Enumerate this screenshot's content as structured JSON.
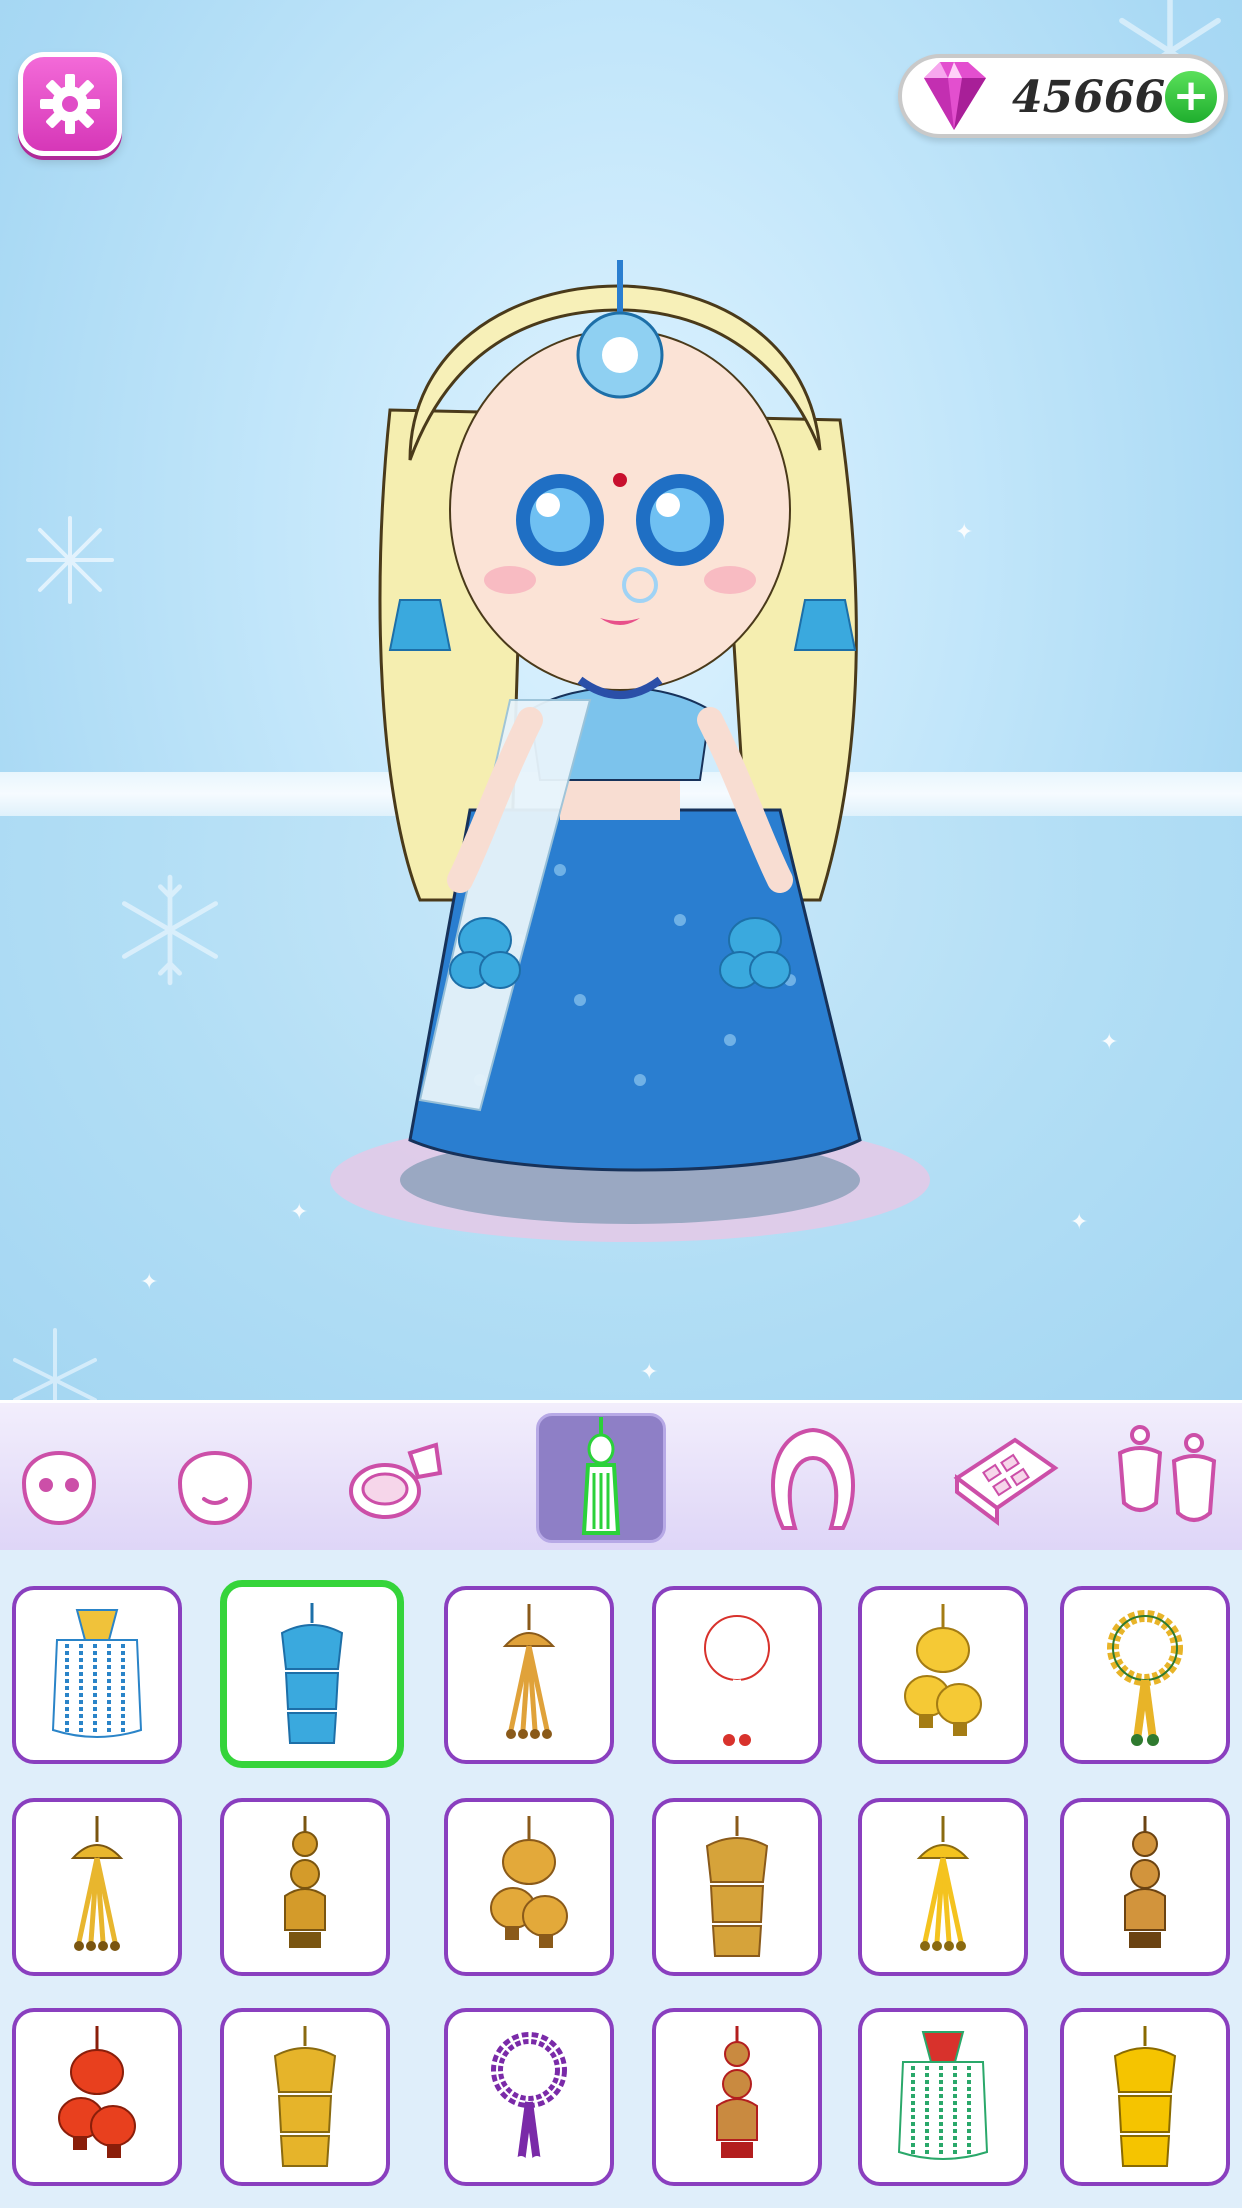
{
  "hud": {
    "gem_count": "45666",
    "settings_icon": "gear-icon",
    "gem_icon": "diamond-gem-icon",
    "add_icon": "plus-icon",
    "add_label": "+"
  },
  "colors": {
    "settings_bg": "#e04cc7",
    "selected_tile_border": "#35d43a",
    "tile_border": "#8a3fbf",
    "active_category_bg": "#8e7fc6"
  },
  "categories": [
    {
      "name": "face-base",
      "icon": "face-base-icon"
    },
    {
      "name": "face-shape",
      "icon": "smiling-face-icon"
    },
    {
      "name": "makeup",
      "icon": "makeup-compact-brush-icon"
    },
    {
      "name": "latkan-tassel",
      "icon": "tassel-icon",
      "active": true
    },
    {
      "name": "hair",
      "icon": "hair-icon"
    },
    {
      "name": "eyeshadow-palette",
      "icon": "eyeshadow-palette-icon"
    },
    {
      "name": "earrings",
      "icon": "earrings-icon"
    }
  ],
  "items": [
    {
      "icon": "beaded-tassel-icon",
      "colors": [
        "#f0c23a",
        "#2a84c8"
      ]
    },
    {
      "icon": "blue-bell-tassel-icon",
      "colors": [
        "#3aa9de",
        "#1d6fa8"
      ],
      "selected": true
    },
    {
      "icon": "gold-bell-tassel-icon",
      "colors": [
        "#e0a23a",
        "#8a5a1a"
      ]
    },
    {
      "icon": "flower-garland-tassel-icon",
      "colors": [
        "#ffffff",
        "#d8322c"
      ]
    },
    {
      "icon": "gold-tiered-tassel-icon",
      "colors": [
        "#f5c935",
        "#a47c14"
      ]
    },
    {
      "icon": "marigold-garland-tassel-icon",
      "colors": [
        "#e8b428",
        "#2f7a2f"
      ]
    },
    {
      "icon": "gold-string-tassel-icon",
      "colors": [
        "#e8b62e",
        "#7a5510"
      ]
    },
    {
      "icon": "gold-chandelier-tassel-icon",
      "colors": [
        "#d49b2a",
        "#7a5510"
      ]
    },
    {
      "icon": "gold-dome-tassel-icon",
      "colors": [
        "#e3a93a",
        "#8a5a1a"
      ]
    },
    {
      "icon": "gold-cluster-tassel-icon",
      "colors": [
        "#d6a33a",
        "#8a5a1a"
      ]
    },
    {
      "icon": "gold-ball-tassel-icon",
      "colors": [
        "#f4c31f",
        "#8a6a10"
      ]
    },
    {
      "icon": "bronze-bell-tassel-icon",
      "colors": [
        "#d2943c",
        "#6b4312"
      ]
    },
    {
      "icon": "red-bell-tassel-icon",
      "colors": [
        "#e8401e",
        "#8a1e0a"
      ]
    },
    {
      "icon": "gold-jhumka-tassel-icon",
      "colors": [
        "#e6b42a",
        "#8a6a10"
      ]
    },
    {
      "icon": "purple-flower-garland-tassel-icon",
      "colors": [
        "#7a2aa8",
        "#ffffff"
      ]
    },
    {
      "icon": "red-gold-jhumka-tassel-icon",
      "colors": [
        "#c98a40",
        "#b31e1e"
      ]
    },
    {
      "icon": "red-beaded-tassel-icon",
      "colors": [
        "#d8322c",
        "#2aa86a"
      ]
    },
    {
      "icon": "yellow-bell-tassel-icon",
      "colors": [
        "#f5c400",
        "#8a6a00"
      ]
    }
  ]
}
